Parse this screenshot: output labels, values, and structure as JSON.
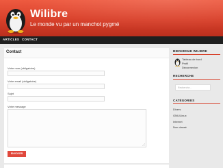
{
  "header": {
    "site_title": "Wilibre",
    "site_description": "Le monde vu par un manchot pygmé",
    "logo_icon": "penguin-logo-icon"
  },
  "nav": {
    "items": [
      {
        "label": "Articles"
      },
      {
        "label": "Contact"
      }
    ]
  },
  "main": {
    "page_title": "Contact",
    "form": {
      "name_label": "Votre nom (obligatoire)",
      "email_label": "Votre email (obligatoire)",
      "subject_label": "Sujet",
      "message_label": "Votre message",
      "name_value": "",
      "email_value": "",
      "subject_value": "",
      "message_value": "",
      "submit_label": "Envoyer"
    }
  },
  "sidebar": {
    "welcome_title": "Bienvenue Wilibre",
    "meta_links": [
      "Tableau de bord",
      "Profil",
      "Déconnexion"
    ],
    "search_title": "Recherche",
    "search_placeholder": "Recherche...",
    "categories_title": "Catégories",
    "categories": [
      "Divers",
      "GNU/Linux",
      "Internet",
      "Non classé"
    ]
  },
  "colors": {
    "accent": "#d8402a",
    "header_top": "#ee5a40",
    "nav_bg": "#1f1f1f",
    "button": "#e0483c"
  }
}
